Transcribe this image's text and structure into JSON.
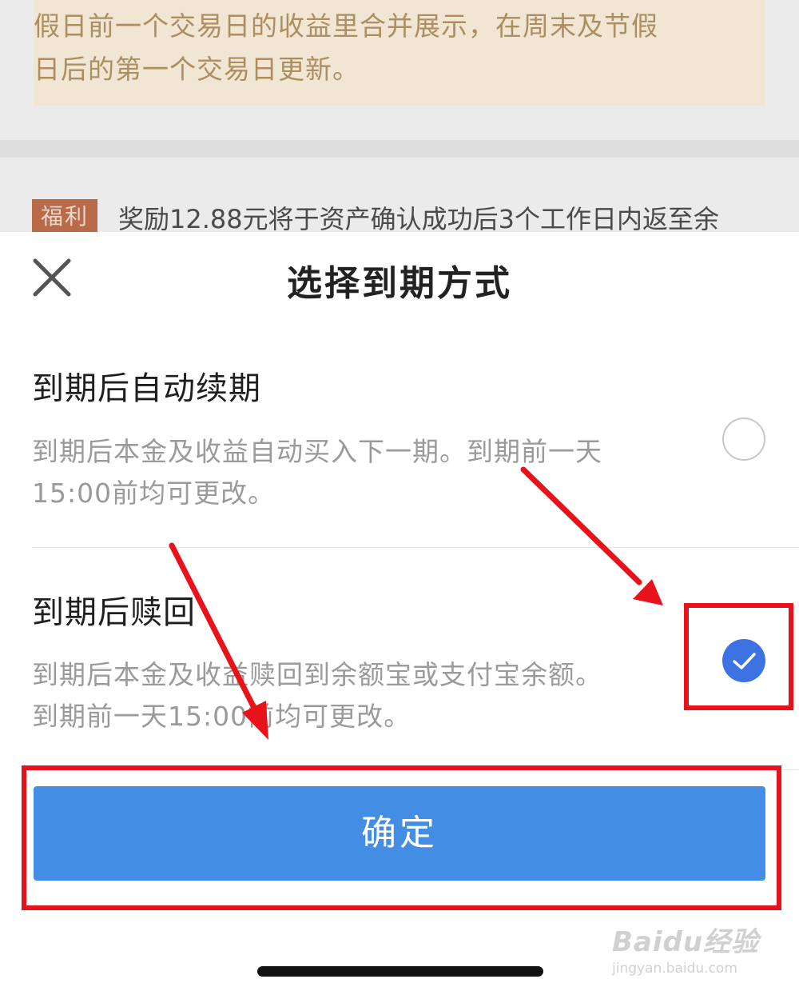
{
  "background": {
    "notice_lines": [
      "假日前一个交易日的收益里合并展示，在周末及节假",
      "日后的第一个交易日更新。"
    ],
    "perk_tag": "福利",
    "perk_text": "奖励12.88元将于资产确认成功后3个工作日内返至余"
  },
  "sheet": {
    "title": "选择到期方式",
    "close_icon": "close-icon",
    "options": [
      {
        "title": "到期后自动续期",
        "desc_lines": [
          "到期后本金及收益自动买入下一期。到期前一天",
          "15:00前均可更改。"
        ],
        "selected": false
      },
      {
        "title": "到期后赎回",
        "desc_lines": [
          "到期后本金及收益赎回到余额宝或支付宝余额。",
          "到期前一天15:00前均可更改。"
        ],
        "selected": true
      }
    ],
    "confirm_label": "确定"
  },
  "watermark": {
    "main": "Baidu经验",
    "sub": "jingyan.baidu.com"
  },
  "colors": {
    "accent": "#438ee4",
    "radio_selected": "#3d72e2",
    "annotation": "#e8131a"
  }
}
